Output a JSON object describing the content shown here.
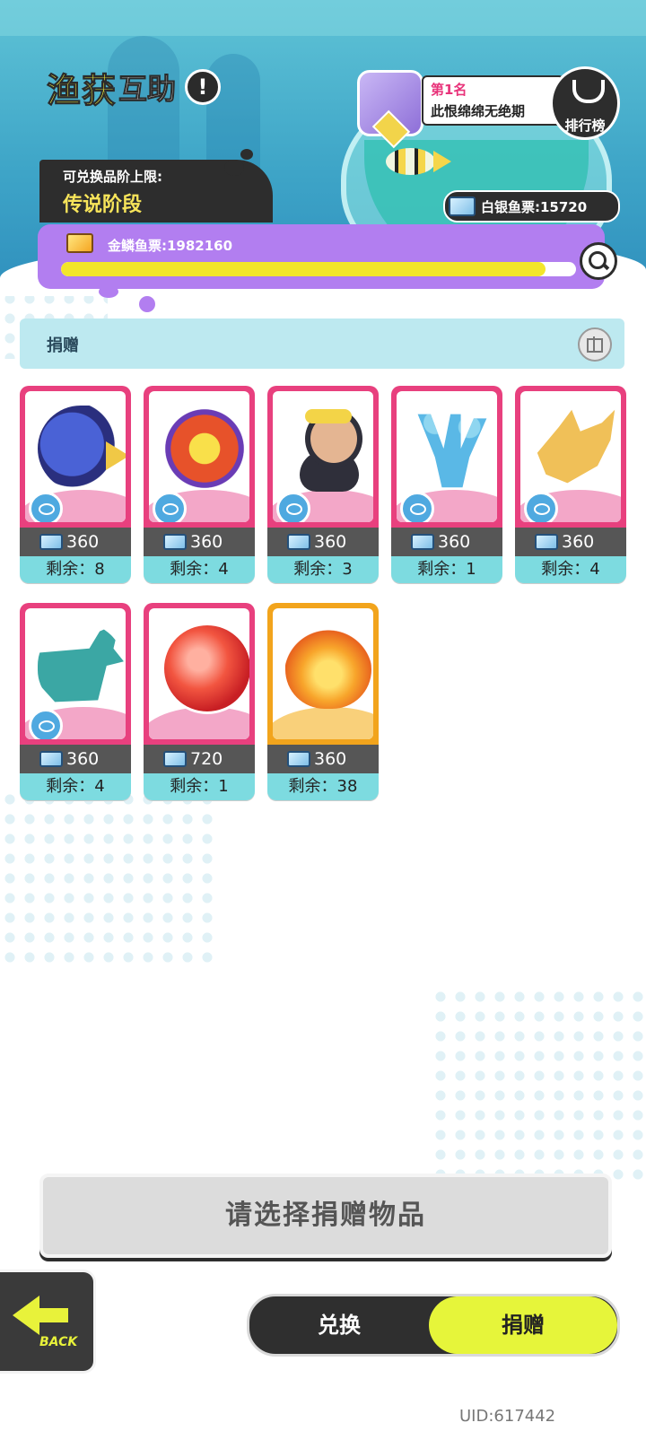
{
  "header": {
    "title_part1": "渔获",
    "title_part2": "互助",
    "info_icon": "!",
    "tier_label": "可兑换品阶上限:",
    "tier_value": "传说阶段"
  },
  "ranking": {
    "rank_text": "第1名",
    "player_name": "此恨绵绵无绝期",
    "leaderboard_label": "排行榜"
  },
  "currency": {
    "silver_text": "白银鱼票:15720",
    "gold_text": "金鳞鱼票:1982160",
    "gold_progress_fraction": 0.94
  },
  "section": {
    "title": "捐赠"
  },
  "items": [
    {
      "name": "blue-fish",
      "price": "360",
      "remaining": "剩余：8",
      "rarity": "pink"
    },
    {
      "name": "orange-fish",
      "price": "360",
      "remaining": "剩余：4",
      "rarity": "pink"
    },
    {
      "name": "diver",
      "price": "360",
      "remaining": "剩余：3",
      "rarity": "pink"
    },
    {
      "name": "coral",
      "price": "360",
      "remaining": "剩余：1",
      "rarity": "pink"
    },
    {
      "name": "shark-skull",
      "price": "360",
      "remaining": "剩余：4",
      "rarity": "pink"
    },
    {
      "name": "whale",
      "price": "360",
      "remaining": "剩余：4",
      "rarity": "pink"
    },
    {
      "name": "red-orb",
      "price": "720",
      "remaining": "剩余：1",
      "rarity": "pink"
    },
    {
      "name": "golden-phoenix-fish",
      "price": "360",
      "remaining": "剩余：38",
      "rarity": "gold"
    }
  ],
  "actions": {
    "select_prompt": "请选择捐赠物品",
    "back_label": "BACK",
    "tab_exchange": "兑换",
    "tab_donate": "捐赠"
  },
  "footer": {
    "uid": "UID:617442"
  },
  "colors": {
    "pink_frame": "#e8407e",
    "gold_frame": "#f2a41c",
    "accent_lime": "#e6f53a",
    "purple_bar": "#b27ef0"
  }
}
